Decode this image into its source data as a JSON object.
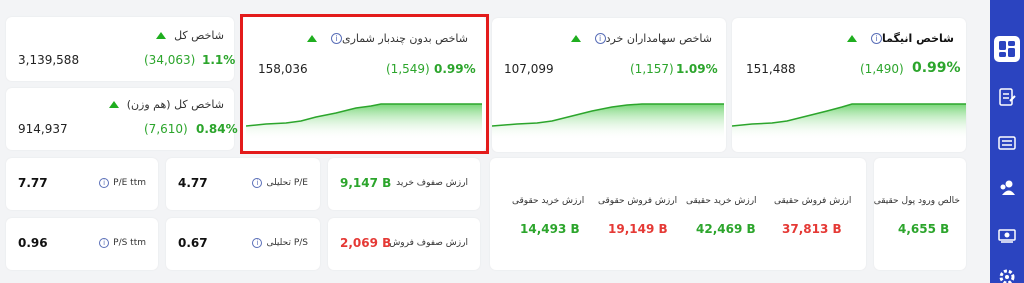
{
  "cards": {
    "main_index": {
      "title": "شاخص کل",
      "value": "3,139,588",
      "change": "(34,063)",
      "percent": "1.1%"
    },
    "main_index_equal": {
      "title": "شاخص کل (هم وزن)",
      "value": "914,937",
      "change": "(7,610)",
      "percent": "0.84%"
    },
    "free_float": {
      "title": "شاخص بدون چندبار شماری",
      "value": "158,036",
      "change": "(1,549)",
      "percent": "0.99%"
    },
    "retail_holders": {
      "title": "شاخص سهامداران خرد",
      "value": "107,099",
      "change": "(1,157)",
      "percent": "1.09%"
    },
    "inigma": {
      "title": "شاخص انیگما",
      "value": "151,488",
      "change": "(1,490)",
      "percent": "0.99%"
    }
  },
  "ratios": {
    "pe_ttm": {
      "label": "P/E ttm",
      "value": "7.77"
    },
    "pe_analytic": {
      "label": "P/E تحلیلی",
      "value": "4.77"
    },
    "ps_ttm": {
      "label": "P/S ttm",
      "value": "0.96"
    },
    "ps_analytic": {
      "label": "P/S تحلیلی",
      "value": "0.67"
    }
  },
  "queues": {
    "buy_queue": {
      "label": "ارزش صفوف خرید",
      "value": "9,147 B"
    },
    "sell_queue": {
      "label": "ارزش صفوف فروش",
      "value": "2,069 B"
    }
  },
  "flows": {
    "legal_buy": {
      "label": "ارزش خرید حقوقی",
      "value": "14,493 B"
    },
    "legal_sell": {
      "label": "ارزش فروش حقوقی",
      "value": "19,149 B"
    },
    "real_buy": {
      "label": "ارزش خرید حقیقی",
      "value": "42,469 B"
    },
    "real_sell": {
      "label": "ارزش فروش حقیقی",
      "value": "37,813 B"
    }
  },
  "net_real_inflow": {
    "label": "خالص ورود پول حقیقی",
    "value": "4,655 B"
  },
  "sidebar": {
    "items": [
      "dashboard-icon",
      "report-icon",
      "ticket-icon",
      "group-icon",
      "money-icon",
      "settings-icon"
    ]
  },
  "colors": {
    "up": "#2ca52c",
    "down": "#e53935",
    "sidebar": "#2b44c0",
    "highlight": "#e31b1b"
  }
}
